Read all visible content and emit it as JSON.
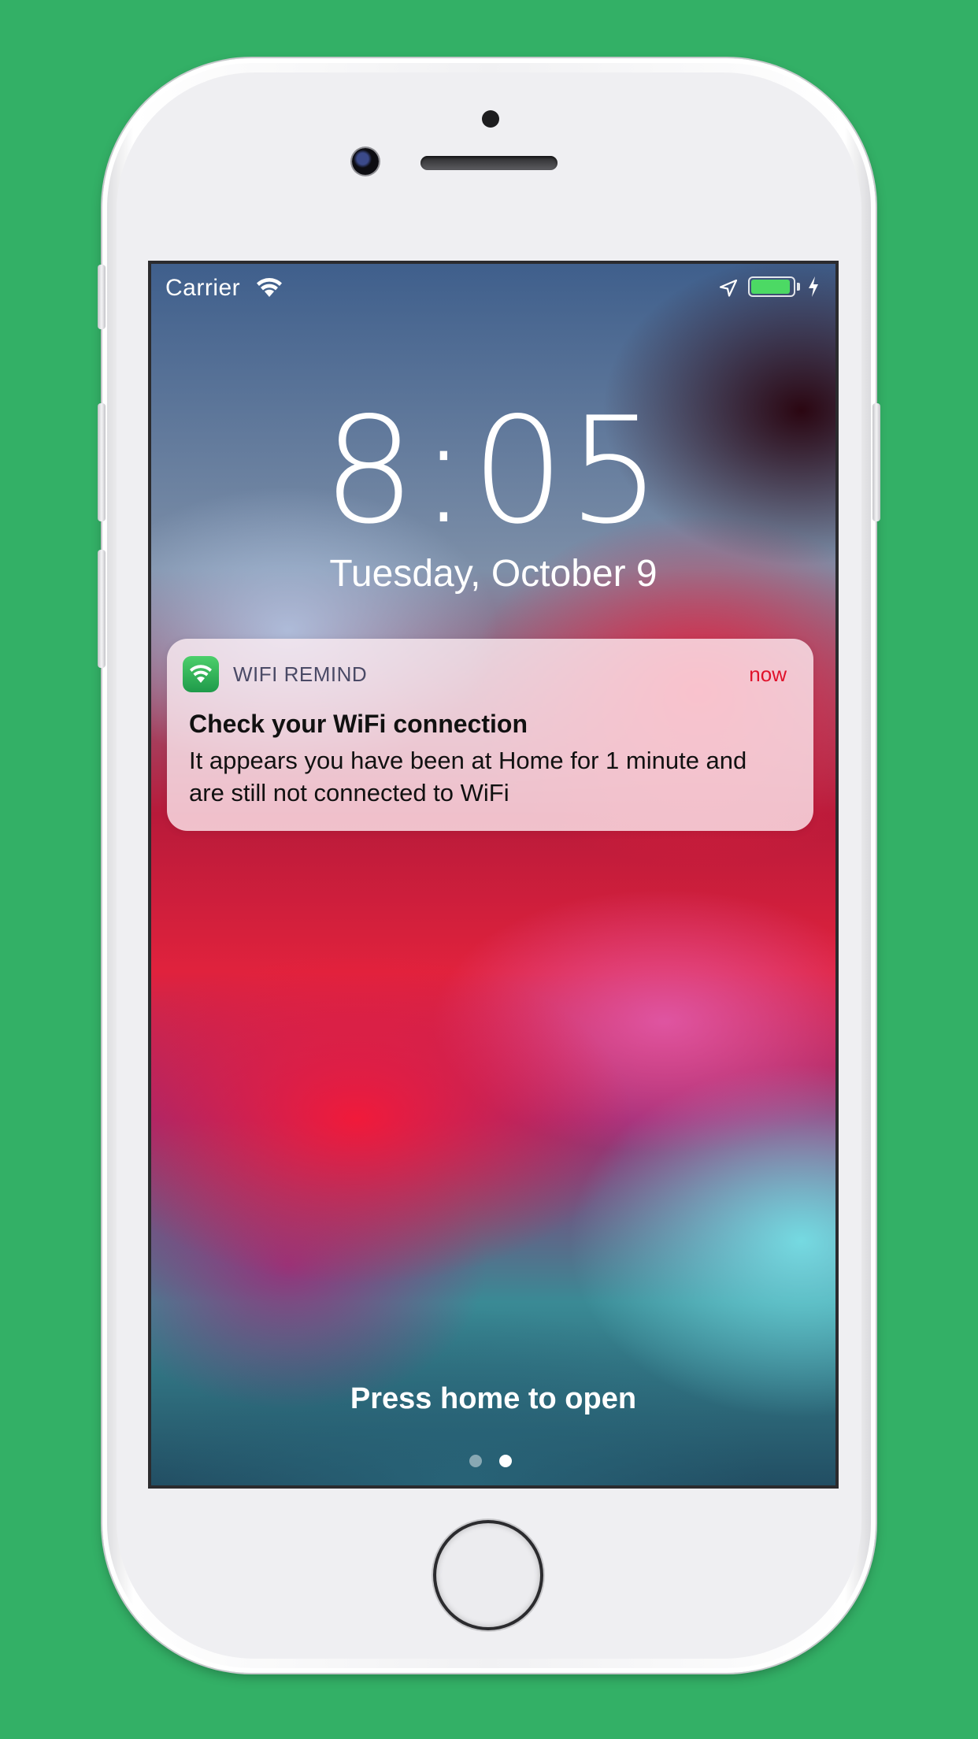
{
  "status_bar": {
    "carrier": "Carrier",
    "wifi_icon": "wifi-icon",
    "location_icon": "location-arrow-icon",
    "battery_icon": "battery-charging-icon",
    "battery_level": 0.95,
    "battery_color": "#4cd964"
  },
  "lock_screen": {
    "time": "8:05",
    "date": "Tuesday, October 9",
    "unlock_hint": "Press home to open",
    "pages": {
      "count": 2,
      "current": 2
    }
  },
  "notification": {
    "app_icon": "wifi-app-icon",
    "app_name": "WIFI REMIND",
    "time": "now",
    "time_color": "#e0112a",
    "title": "Check your WiFi connection",
    "body": "It appears you have been at Home for 1 minute and are still not connected to WiFi"
  },
  "colors": {
    "background": "#33b066"
  }
}
